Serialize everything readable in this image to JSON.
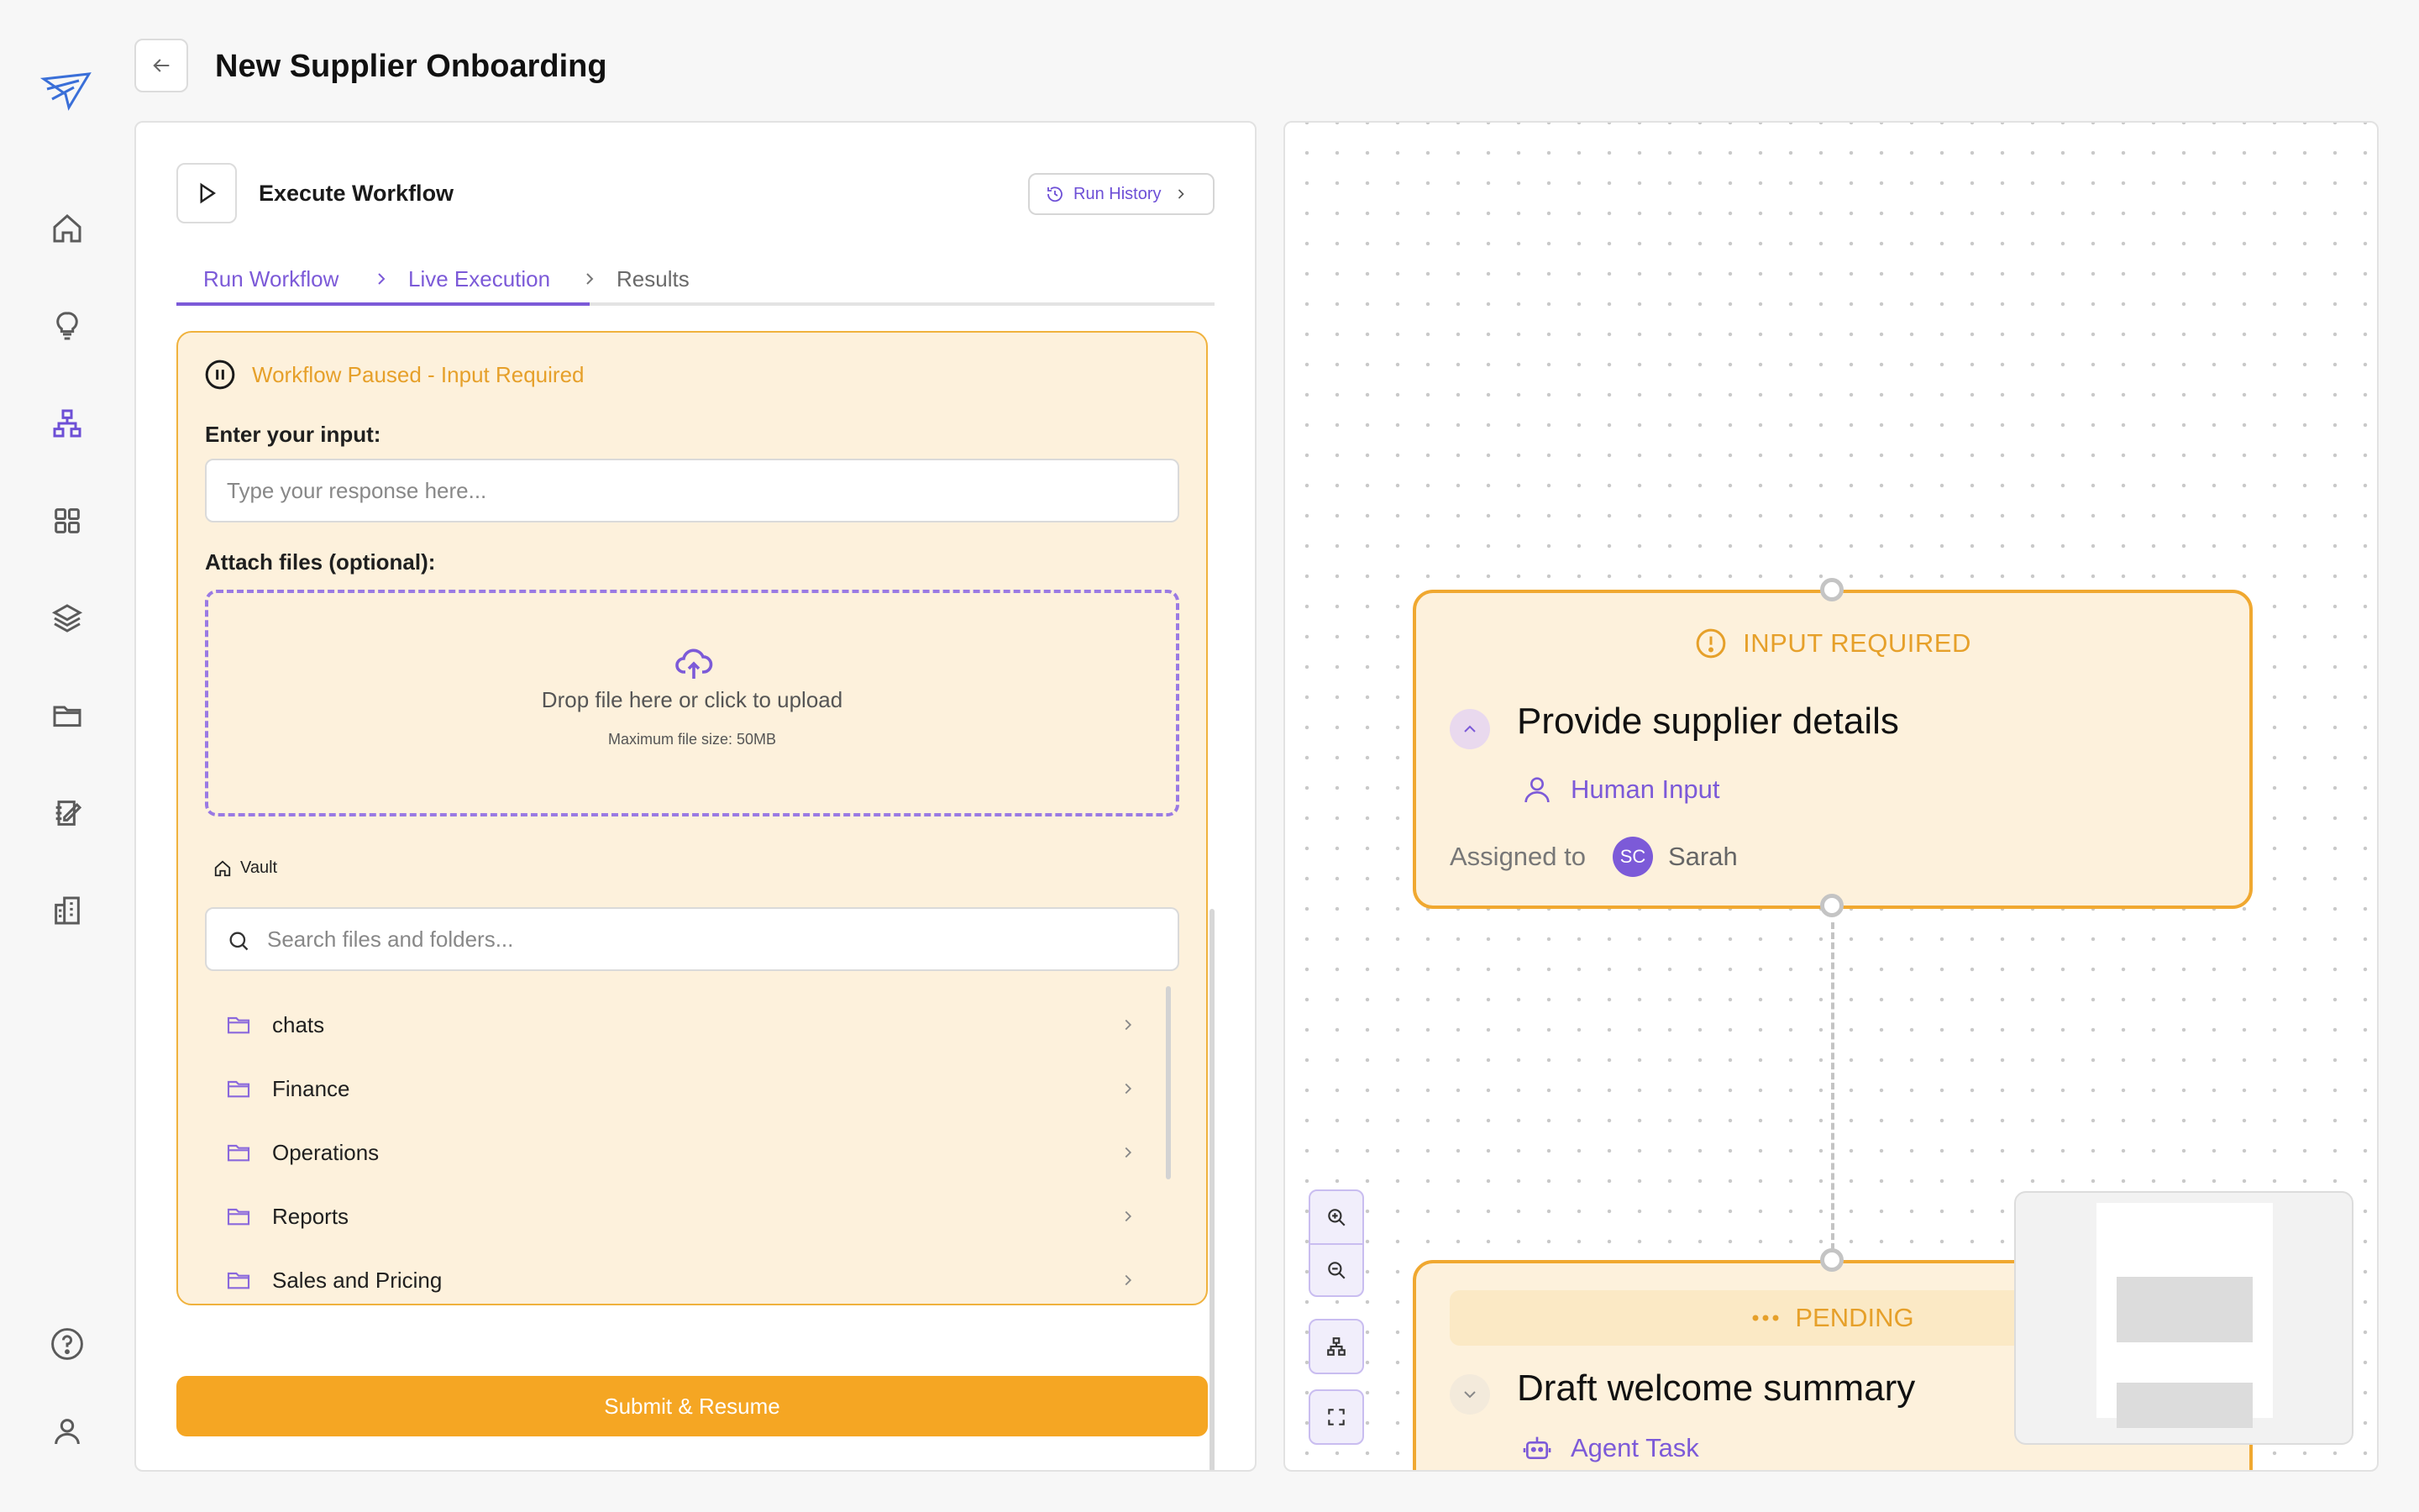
{
  "header": {
    "title": "New Supplier Onboarding"
  },
  "nav": {
    "items": [
      "home-icon",
      "lightbulb-icon",
      "workflow-icon",
      "grid-icon",
      "layers-icon",
      "folder-icon",
      "notes-icon",
      "building-icon",
      "help-icon",
      "user-icon"
    ],
    "active": "workflow-icon"
  },
  "execute": {
    "title": "Execute Workflow",
    "run_history": "Run History",
    "steps": [
      "Run Workflow",
      "Live Execution",
      "Results"
    ]
  },
  "paused": {
    "status": "Workflow Paused - Input Required",
    "input_label": "Enter your input:",
    "input_placeholder": "Type your response here...",
    "attach_label": "Attach files (optional):",
    "drop_text": "Drop file here or click to upload",
    "drop_sub": "Maximum file size: 50MB",
    "vault": "Vault",
    "search_placeholder": "Search files and folders...",
    "folders": [
      "chats",
      "Finance",
      "Operations",
      "Reports",
      "Sales and Pricing"
    ],
    "submit": "Submit & Resume"
  },
  "canvas": {
    "node1": {
      "status": "INPUT REQUIRED",
      "title": "Provide supplier details",
      "type": "Human Input",
      "assigned_label": "Assigned to",
      "avatar": "SC",
      "assignee": "Sarah"
    },
    "node2": {
      "status": "PENDING",
      "title": "Draft welcome summary",
      "type": "Agent Task"
    }
  },
  "colors": {
    "accent": "#7c5ad8",
    "warning": "#f0a830",
    "submit": "#f5a623",
    "card_bg": "#fdf1dc"
  }
}
